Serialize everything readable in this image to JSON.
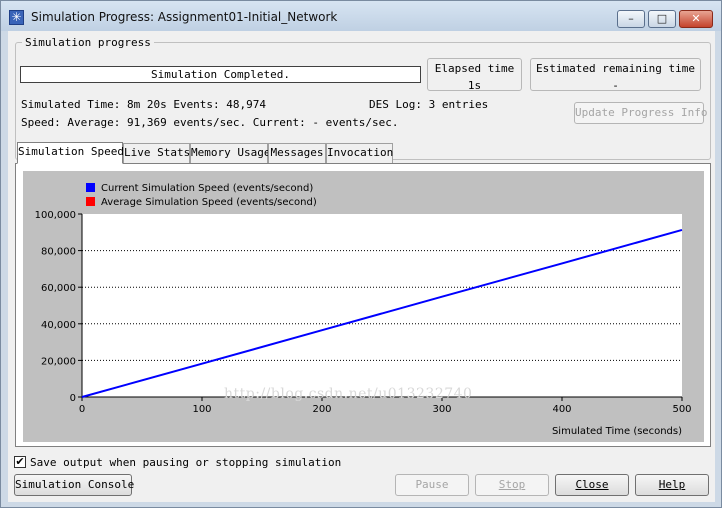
{
  "window": {
    "title": "Simulation Progress: Assignment01-Initial_Network",
    "minimize": "–",
    "maximize": "□",
    "close": "✕",
    "app_icon": "✳",
    "app_icon_name": "simulation-star-icon"
  },
  "progress": {
    "group_label": "Simulation progress",
    "status": "Simulation Completed.",
    "elapsed_label": "Elapsed time",
    "elapsed_value": "1s",
    "remaining_label": "Estimated remaining time",
    "remaining_value": "-",
    "simulated_time": "Simulated Time: 8m 20s Events: 48,974",
    "des_log": "DES Log: 3 entries",
    "speed": "Speed: Average: 91,369 events/sec. Current: - events/sec.",
    "update_button": "Update Progress Info"
  },
  "tabs": [
    "Simulation Speed",
    "Live Stats",
    "Memory Usage",
    "Messages",
    "Invocation"
  ],
  "chart_data": {
    "type": "line",
    "xlabel": "Simulated Time (seconds)",
    "ylabel": "",
    "xlim": [
      0,
      500
    ],
    "ylim": [
      0,
      100000
    ],
    "x_ticks": [
      0,
      100,
      200,
      300,
      400,
      500
    ],
    "y_ticks": [
      0,
      20000,
      40000,
      60000,
      80000,
      100000
    ],
    "x_tick_labels": [
      "0",
      "100",
      "200",
      "300",
      "400",
      "500"
    ],
    "y_tick_labels": [
      "0",
      "20,000",
      "40,000",
      "60,000",
      "80,000",
      "100,000"
    ],
    "grid": "horizontal",
    "legend_position": "top-left",
    "series": [
      {
        "name": "Current Simulation Speed (events/second)",
        "color": "#0000ff",
        "x": [
          0,
          100,
          200,
          300,
          400,
          500
        ],
        "y": [
          0,
          18200,
          36500,
          54800,
          73000,
          91300
        ]
      },
      {
        "name": "Average Simulation Speed (events/second)",
        "color": "#ff0000",
        "x": [],
        "y": []
      }
    ],
    "annotation": "http://blog.csdn.net/u013232740"
  },
  "footer": {
    "save_output_label": "Save output when pausing or stopping simulation",
    "save_output_checked": true,
    "console_button": "Simulation Console",
    "pause_button": "Pause",
    "stop_button": "Stop",
    "close_button": "Close",
    "help_button": "Help"
  }
}
